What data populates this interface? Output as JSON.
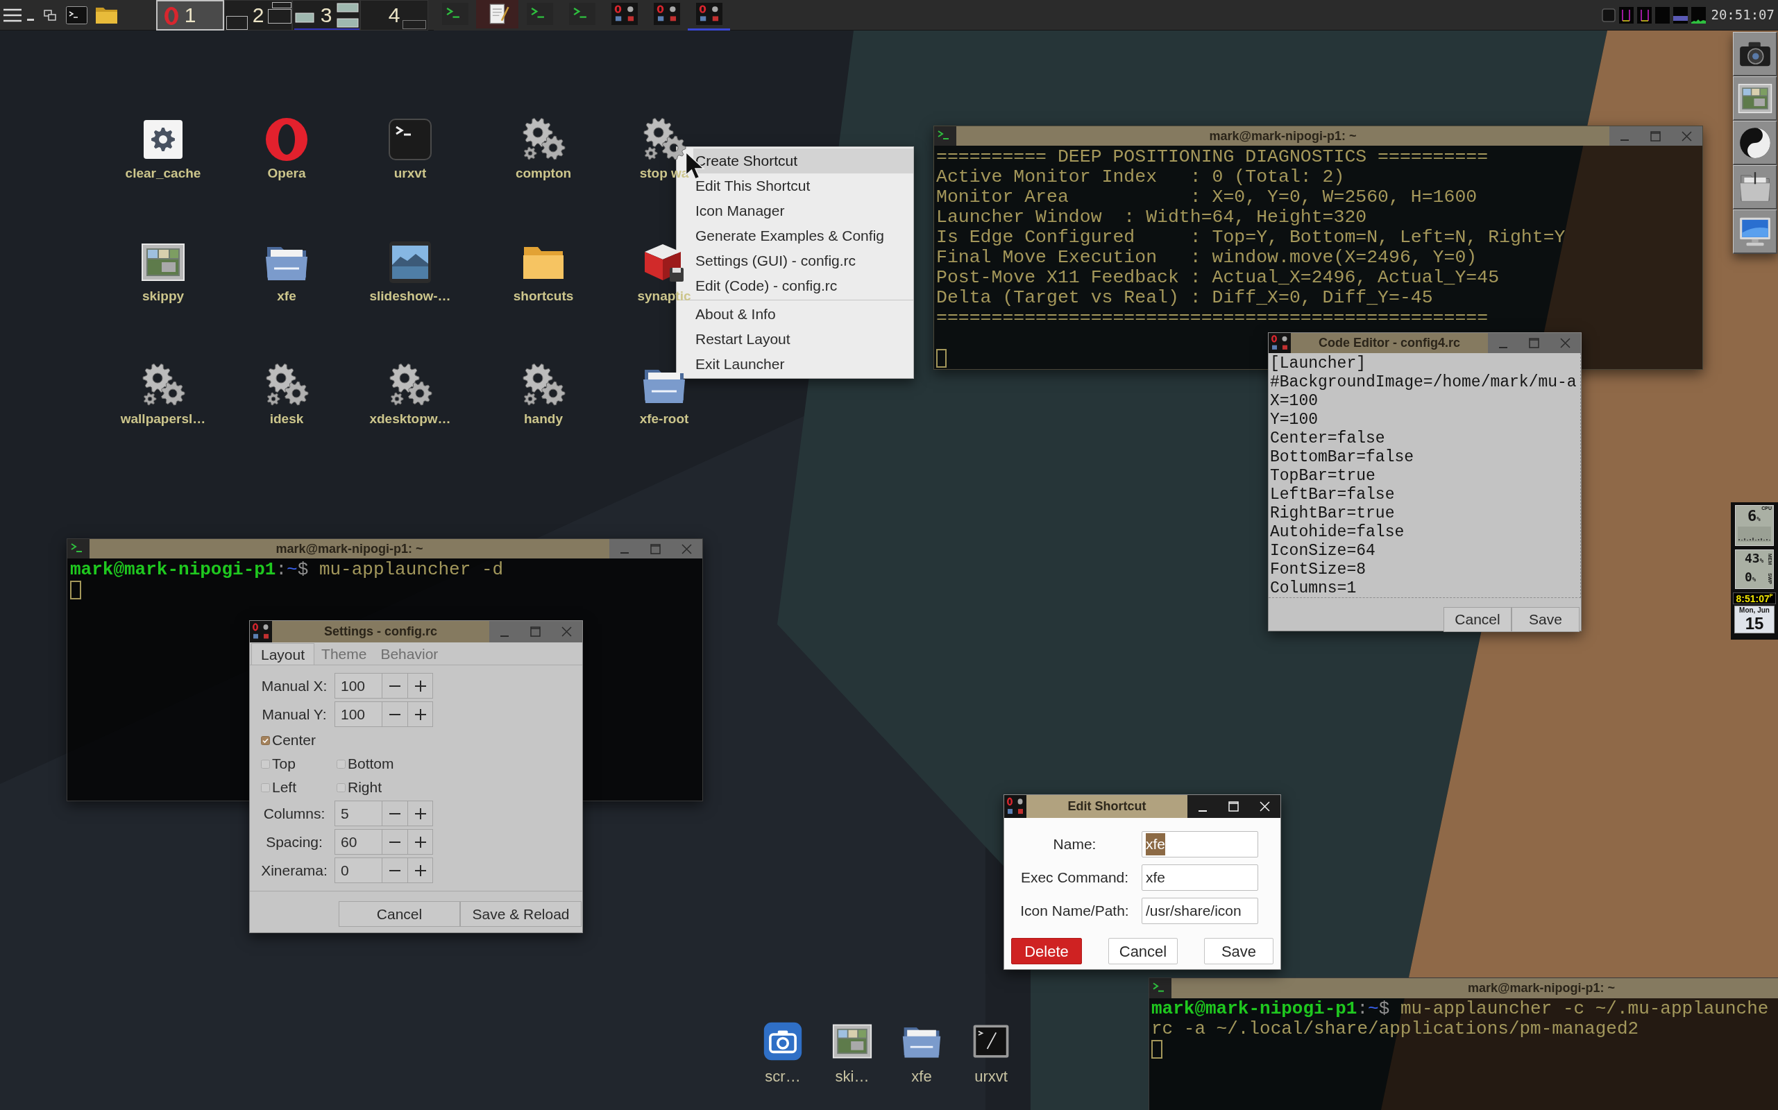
{
  "top_panel": {
    "workspaces": [
      {
        "label": "1",
        "selected": true
      },
      {
        "label": "2",
        "selected": false
      },
      {
        "label": "3",
        "selected": false
      },
      {
        "label": "4",
        "selected": false
      }
    ],
    "tasks": [
      {
        "kind": "terminal",
        "selected": false,
        "highlighted": false
      },
      {
        "kind": "editor",
        "selected": false,
        "highlighted": true
      },
      {
        "kind": "terminal",
        "selected": false,
        "highlighted": false
      },
      {
        "kind": "terminal",
        "selected": false,
        "highlighted": false
      },
      {
        "kind": "launcher",
        "selected": false,
        "highlighted": false
      },
      {
        "kind": "launcher",
        "selected": false,
        "highlighted": false
      },
      {
        "kind": "launcher",
        "selected": true,
        "highlighted": false
      }
    ],
    "clock": "20:51:07"
  },
  "desktop_icons": [
    {
      "label": "clear_cache",
      "kind": "settings"
    },
    {
      "label": "Opera",
      "kind": "browser"
    },
    {
      "label": "urxvt",
      "kind": "terminal"
    },
    {
      "label": "compton",
      "kind": "gears"
    },
    {
      "label": "stop wa",
      "kind": "gears"
    },
    {
      "label": "skippy",
      "kind": "thumbnails"
    },
    {
      "label": "xfe",
      "kind": "file_manager"
    },
    {
      "label": "slideshow-…",
      "kind": "picture"
    },
    {
      "label": "shortcuts",
      "kind": "folder"
    },
    {
      "label": "synaptic",
      "kind": "package"
    },
    {
      "label": "wallpapersl…",
      "kind": "gears"
    },
    {
      "label": "idesk",
      "kind": "gears"
    },
    {
      "label": "xdesktopw…",
      "kind": "gears"
    },
    {
      "label": "handy",
      "kind": "gears"
    },
    {
      "label": "xfe-root",
      "kind": "file_manager"
    }
  ],
  "context_menu": {
    "sections": [
      {
        "items": [
          {
            "label": "Create Shortcut",
            "selected": true
          },
          {
            "label": "Edit This Shortcut",
            "selected": false
          },
          {
            "label": "Icon Manager",
            "selected": false
          },
          {
            "label": "Generate Examples & Config",
            "selected": false
          },
          {
            "label": "Settings (GUI) - config.rc",
            "selected": false
          },
          {
            "label": "Edit (Code) - config.rc",
            "selected": false
          }
        ]
      },
      {
        "items": [
          {
            "label": "About & Info",
            "selected": false
          },
          {
            "label": "Restart Layout",
            "selected": false
          },
          {
            "label": "Exit Launcher",
            "selected": false
          }
        ]
      }
    ]
  },
  "diagnostics_terminal": {
    "title": "mark@mark-nipogi-p1: ~",
    "active": false,
    "lines": [
      "========== DEEP POSITIONING DIAGNOSTICS ==========",
      "Active Monitor Index   : 0 (Total: 2)",
      "Monitor Area           : X=0, Y=0, W=2560, H=1600",
      "Launcher Window  : Width=64, Height=320",
      "Is Edge Configured     : Top=Y, Bottom=N, Left=N, Right=Y",
      "Final Move Execution   : window.move(X=2496, Y=0)",
      "Post-Move X11 Feedback : Actual_X=2496, Actual_Y=45",
      "Delta (Target vs Real) : Diff_X=0, Diff_Y=-45",
      "=================================================="
    ]
  },
  "code_editor": {
    "title": "Code Editor - config4.rc",
    "active": false,
    "lines": [
      "[Launcher]",
      "#BackgroundImage=/home/mark/mu-a",
      "X=100",
      "Y=100",
      "Center=false",
      "BottomBar=false",
      "TopBar=true",
      "LeftBar=false",
      "RightBar=true",
      "Autohide=false",
      "IconSize=64",
      "FontSize=8",
      "Columns=1"
    ],
    "buttons": [
      "Cancel",
      "Save"
    ]
  },
  "shell_terminal": {
    "title": "mark@mark-nipogi-p1: ~",
    "active": false,
    "lines": [
      {
        "segments": [
          {
            "kind": "user",
            "text": "mark@mark-nipogi-p1"
          },
          {
            "kind": "punct",
            "text": ":"
          },
          {
            "kind": "path",
            "text": "~"
          },
          {
            "kind": "punct",
            "text": "$"
          },
          {
            "kind": "command",
            "text": "mu-applauncher -d"
          }
        ]
      }
    ]
  },
  "settings_dialog": {
    "title": "Settings - config.rc",
    "active": false,
    "tabs": [
      {
        "label": "Layout",
        "selected": true
      },
      {
        "label": "Theme",
        "selected": false
      },
      {
        "label": "Behavior",
        "selected": false
      }
    ],
    "rows": [
      {
        "kind": "spin",
        "label": "Manual X:",
        "value": "100"
      },
      {
        "kind": "spin",
        "label": "Manual Y:",
        "value": "100"
      },
      {
        "kind": "checks",
        "items": [
          {
            "label": "Center",
            "checked": true
          }
        ]
      },
      {
        "kind": "checks",
        "items": [
          {
            "label": "Top",
            "checked": false
          },
          {
            "label": "Bottom",
            "checked": false
          }
        ]
      },
      {
        "kind": "checks",
        "items": [
          {
            "label": "Left",
            "checked": false
          },
          {
            "label": "Right",
            "checked": false
          }
        ]
      },
      {
        "kind": "spin",
        "label": "Columns:",
        "value": "5"
      },
      {
        "kind": "spin",
        "label": "Spacing:",
        "value": "60"
      },
      {
        "kind": "spin",
        "label": "Xinerama:",
        "value": "0"
      }
    ],
    "buttons": [
      "Cancel",
      "Save & Reload"
    ]
  },
  "edit_shortcut_dialog": {
    "title": "Edit Shortcut",
    "active": true,
    "fields": [
      {
        "label": "Name:",
        "value": "xfe",
        "text_selected": true
      },
      {
        "label": "Exec Command:",
        "value": "xfe",
        "text_selected": false
      },
      {
        "label": "Icon Name/Path:",
        "value": "/usr/share/icon",
        "text_selected": false
      }
    ],
    "buttons": [
      {
        "label": "Delete",
        "kind": "danger"
      },
      {
        "label": "Cancel",
        "kind": "normal"
      },
      {
        "label": "Save",
        "kind": "normal"
      }
    ]
  },
  "install_terminal": {
    "title": "mark@mark-nipogi-p1: ~",
    "active": false,
    "lines": [
      {
        "segments": [
          {
            "kind": "user",
            "text": "mark@mark-nipogi-p1"
          },
          {
            "kind": "punct",
            "text": ":"
          },
          {
            "kind": "path",
            "text": "~"
          },
          {
            "kind": "punct",
            "text": "$"
          },
          {
            "kind": "command",
            "text": "mu-applauncher -c ~/.mu-applaunche"
          }
        ]
      },
      {
        "segments": [
          {
            "kind": "command",
            "text": "rc -a ~/.local/share/applications/pm-managed2"
          }
        ]
      }
    ]
  },
  "dock": {
    "items": [
      {
        "label": "scr…",
        "kind": "screenshot"
      },
      {
        "label": "ski…",
        "kind": "thumbnails"
      },
      {
        "label": "xfe",
        "kind": "file_manager"
      },
      {
        "label": "urxvt",
        "kind": "console"
      }
    ]
  },
  "system_monitor": {
    "cpu": {
      "value": "6",
      "unit": "%",
      "label": "CPU"
    },
    "memory": {
      "value": "43",
      "unit": "%",
      "label": "MEM"
    },
    "swap": {
      "value": "0",
      "unit": "%",
      "label": "SWP"
    },
    "clock": {
      "time": "8:51:07",
      "suffix": "P"
    },
    "calendar": {
      "date": "Mon, Jun",
      "day": "15"
    }
  }
}
